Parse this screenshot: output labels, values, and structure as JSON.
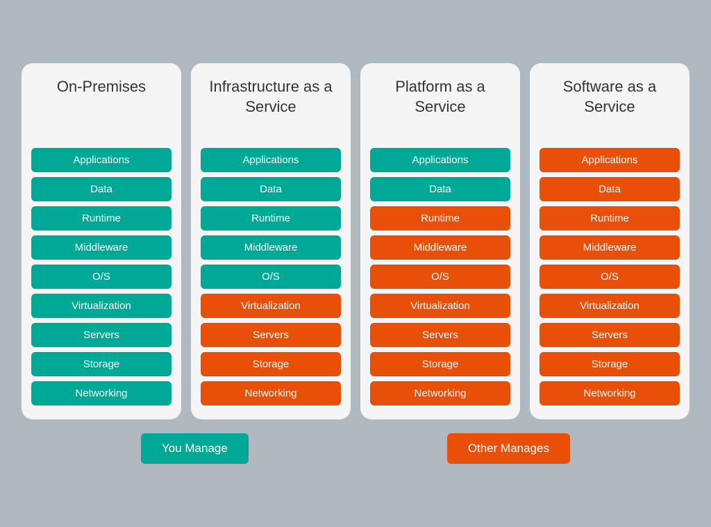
{
  "columns": [
    {
      "id": "on-premises",
      "title": "On-Premises",
      "items": [
        {
          "label": "Applications",
          "color": "teal"
        },
        {
          "label": "Data",
          "color": "teal"
        },
        {
          "label": "Runtime",
          "color": "teal"
        },
        {
          "label": "Middleware",
          "color": "teal"
        },
        {
          "label": "O/S",
          "color": "teal"
        },
        {
          "label": "Virtualization",
          "color": "teal"
        },
        {
          "label": "Servers",
          "color": "teal"
        },
        {
          "label": "Storage",
          "color": "teal"
        },
        {
          "label": "Networking",
          "color": "teal"
        }
      ]
    },
    {
      "id": "iaas",
      "title": "Infrastructure as a Service",
      "items": [
        {
          "label": "Applications",
          "color": "teal"
        },
        {
          "label": "Data",
          "color": "teal"
        },
        {
          "label": "Runtime",
          "color": "teal"
        },
        {
          "label": "Middleware",
          "color": "teal"
        },
        {
          "label": "O/S",
          "color": "teal"
        },
        {
          "label": "Virtualization",
          "color": "orange"
        },
        {
          "label": "Servers",
          "color": "orange"
        },
        {
          "label": "Storage",
          "color": "orange"
        },
        {
          "label": "Networking",
          "color": "orange"
        }
      ]
    },
    {
      "id": "paas",
      "title": "Platform as a Service",
      "items": [
        {
          "label": "Applications",
          "color": "teal"
        },
        {
          "label": "Data",
          "color": "teal"
        },
        {
          "label": "Runtime",
          "color": "orange"
        },
        {
          "label": "Middleware",
          "color": "orange"
        },
        {
          "label": "O/S",
          "color": "orange"
        },
        {
          "label": "Virtualization",
          "color": "orange"
        },
        {
          "label": "Servers",
          "color": "orange"
        },
        {
          "label": "Storage",
          "color": "orange"
        },
        {
          "label": "Networking",
          "color": "orange"
        }
      ]
    },
    {
      "id": "saas",
      "title": "Software as a Service",
      "items": [
        {
          "label": "Applications",
          "color": "orange"
        },
        {
          "label": "Data",
          "color": "orange"
        },
        {
          "label": "Runtime",
          "color": "orange"
        },
        {
          "label": "Middleware",
          "color": "orange"
        },
        {
          "label": "O/S",
          "color": "orange"
        },
        {
          "label": "Virtualization",
          "color": "orange"
        },
        {
          "label": "Servers",
          "color": "orange"
        },
        {
          "label": "Storage",
          "color": "orange"
        },
        {
          "label": "Networking",
          "color": "orange"
        }
      ]
    }
  ],
  "legend": {
    "you_manage": "You Manage",
    "other_manages": "Other Manages",
    "you_manage_color": "teal",
    "other_manages_color": "orange"
  }
}
